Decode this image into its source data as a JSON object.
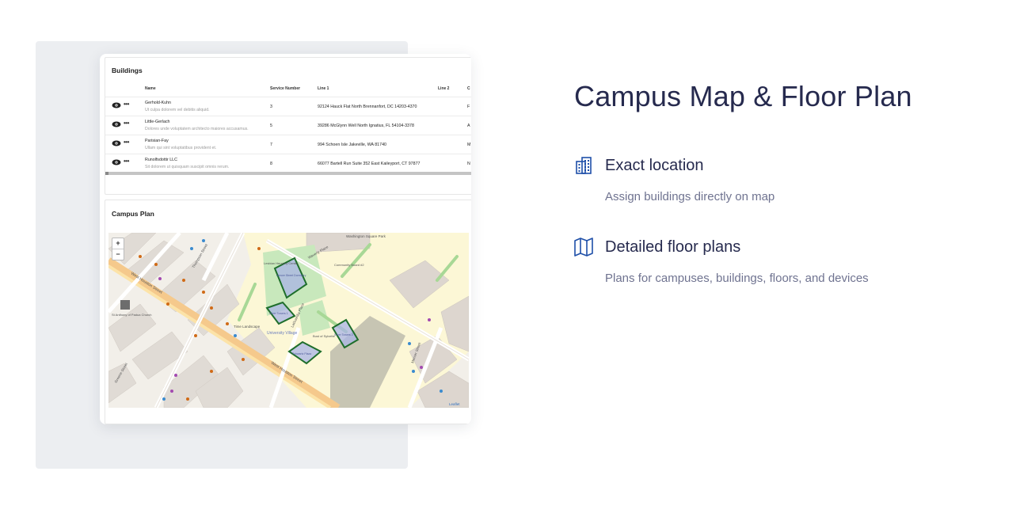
{
  "hero": {
    "title": "Campus Map & Floor Plan"
  },
  "features": [
    {
      "icon": "building-icon",
      "title": "Exact location",
      "description": "Assign buildings directly on map"
    },
    {
      "icon": "map-icon",
      "title": "Detailed floor plans",
      "description": "Plans for campuses, buildings, floors, and devices"
    }
  ],
  "buildings_panel": {
    "title": "Buildings",
    "columns": [
      "Name",
      "Service Number",
      "Line 1",
      "Line 2",
      "C"
    ],
    "rows": [
      {
        "name": "Gerhold-Kuhn",
        "subtitle": "Ut culpa dolorem vel debitis aliquid.",
        "service_number": "3",
        "line1": "92124 Hauck Flat North Brennanfort, DC 14203-4370",
        "line2": "",
        "cut": "F"
      },
      {
        "name": "Little-Gerlach",
        "subtitle": "Dolores unde voluptatem architecto maiores accusamus.",
        "service_number": "5",
        "line1": "39286 McGlynn Well North Ignatius, FL 54104-3378",
        "line2": "",
        "cut": "A"
      },
      {
        "name": "Parisian-Fay",
        "subtitle": "Ullam qui sint voluptatibus provident et.",
        "service_number": "7",
        "line1": "994 Schoen Isle Jakeville, WA 81740",
        "line2": "",
        "cut": "M"
      },
      {
        "name": "Runolfsdottir LLC",
        "subtitle": "Sit dolorem ut quisquam suscipit omnis rerum.",
        "service_number": "8",
        "line1": "66077 Bartell Run Suite 352 East Kaileyport, CT 97877",
        "line2": "",
        "cut": "N"
      }
    ]
  },
  "campus_panel": {
    "title": "Campus Plan",
    "zoom_in": "+",
    "zoom_out": "−",
    "map_labels": {
      "washington_square": "Washington Square Park",
      "waverly": "Waverly Place",
      "west_houston_1": "West Houston Street",
      "west_houston_2": "West Houston Street",
      "thompson": "Thompson Street",
      "mercer": "Mercer Street",
      "laguardia": "LaGuardia Place",
      "greene": "Greene Street",
      "community_board": "Community Board #2",
      "lesbian_center": "Lesbian Herstory Center",
      "university_village": "University Village",
      "time_landscape": "Time Landscape",
      "bust_of_sylvette": "Bust of Sylvette",
      "st_anthony": "St Anthony of Padua Church",
      "leaflet": "Leaflet",
      "building_a": "Mercer Street Dormitory",
      "building_b": "Silver Towers 1",
      "building_c": "Silver Towers 2",
      "building_d": "Schwartz Plaza"
    }
  }
}
